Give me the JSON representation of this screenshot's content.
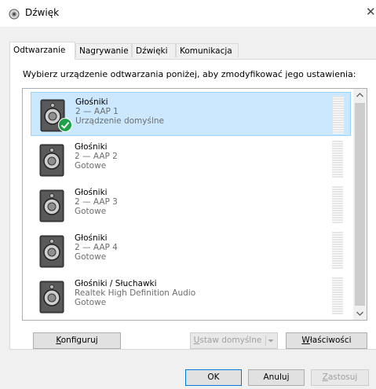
{
  "window": {
    "title": "Dźwięk",
    "close_glyph": "✕",
    "icon": "speaker-app-icon"
  },
  "tabs": [
    {
      "label": "Odtwarzanie",
      "active": true
    },
    {
      "label": "Nagrywanie",
      "active": false
    },
    {
      "label": "Dźwięki",
      "active": false
    },
    {
      "label": "Komunikacja",
      "active": false
    }
  ],
  "instruction": "Wybierz urządzenie odtwarzania poniżej, aby zmodyfikować jego ustawienia:",
  "devices": [
    {
      "name": "Głośniki",
      "line1": "2 — AAP 1",
      "line2": "Urządzenie domyślne",
      "selected": true,
      "default": true
    },
    {
      "name": "Głośniki",
      "line1": "2 — AAP 2",
      "line2": "Gotowe",
      "selected": false,
      "default": false
    },
    {
      "name": "Głośniki",
      "line1": "2 — AAP 3",
      "line2": "Gotowe",
      "selected": false,
      "default": false
    },
    {
      "name": "Głośniki",
      "line1": "2 — AAP 4",
      "line2": "Gotowe",
      "selected": false,
      "default": false
    },
    {
      "name": "Głośniki / Słuchawki",
      "line1": "Realtek High Definition Audio",
      "line2": "Gotowe",
      "selected": false,
      "default": false
    }
  ],
  "buttons": {
    "configure": {
      "label_prefix": "K",
      "label_rest": "onfiguruj"
    },
    "set_default": {
      "label_prefix": "U",
      "label_rest": "staw domyślne",
      "disabled": true
    },
    "properties": {
      "label_prefix": "W",
      "label_rest": "łaściwości"
    },
    "ok": "OK",
    "cancel": "Anuluj",
    "apply": {
      "label_prefix": "Z",
      "label_rest": "astosuj",
      "disabled": true
    }
  },
  "colors": {
    "selection_bg": "#cce8ff",
    "selection_border": "#99d1ff",
    "default_check": "#1fa14a",
    "accent": "#0078d7"
  }
}
